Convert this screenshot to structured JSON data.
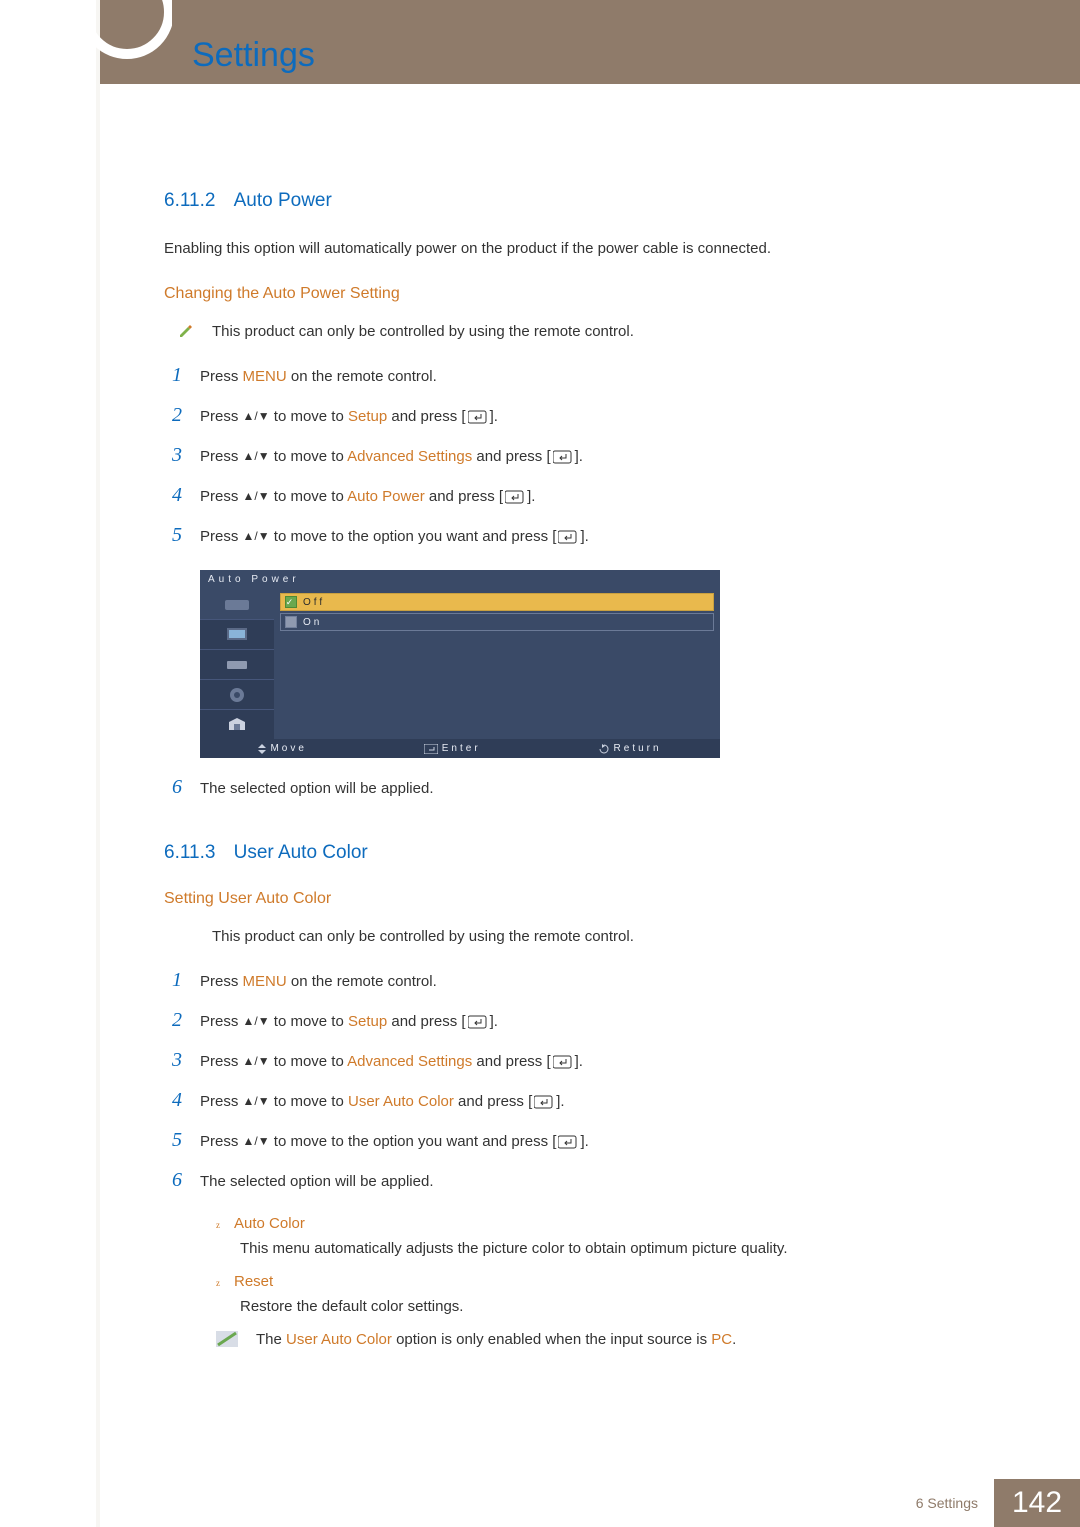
{
  "header": {
    "chapter_title": "Settings"
  },
  "section_a": {
    "num": "6.11.2",
    "title": "Auto Power",
    "intro": "Enabling this option will automatically power on the product if the power cable is connected.",
    "subhead": "Changing the Auto Power Setting",
    "note": "This product can only be controlled by using the remote control.",
    "steps": {
      "s1": {
        "n": "1",
        "a": "Press ",
        "menu": "MENU",
        "b": " on the remote control."
      },
      "s2": {
        "n": "2",
        "a": "Press ",
        "arrows": "▲/▼",
        "b": " to move to ",
        "t": "Setup",
        "c": " and press [",
        "d": "]."
      },
      "s3": {
        "n": "3",
        "a": "Press ",
        "arrows": "▲/▼",
        "b": " to move to ",
        "t": "Advanced Settings",
        "c": " and press [",
        "d": "]."
      },
      "s4": {
        "n": "4",
        "a": "Press ",
        "arrows": "▲/▼",
        "b": " to move to ",
        "t": "Auto Power",
        "c": " and press [",
        "d": "]."
      },
      "s5": {
        "n": "5",
        "a": "Press ",
        "arrows": "▲/▼",
        "b": " to move to the option you want and press [",
        "d": "]."
      },
      "s6": {
        "n": "6",
        "a": "The selected option will be applied."
      }
    }
  },
  "osd": {
    "title": "Auto Power",
    "opt_off": "Off",
    "opt_on": "On",
    "footer_move": "Move",
    "footer_enter": "Enter",
    "footer_return": "Return"
  },
  "section_b": {
    "num": "6.11.3",
    "title": "User Auto Color",
    "subhead": "Setting User Auto Color",
    "note": "This product can only be controlled by using the remote control.",
    "steps": {
      "s1": {
        "n": "1",
        "a": "Press ",
        "menu": "MENU",
        "b": " on the remote control."
      },
      "s2": {
        "n": "2",
        "a": "Press ",
        "arrows": "▲/▼",
        "b": " to move to ",
        "t": "Setup",
        "c": " and press [",
        "d": "]."
      },
      "s3": {
        "n": "3",
        "a": "Press ",
        "arrows": "▲/▼",
        "b": " to move to ",
        "t": "Advanced Settings",
        "c": " and press [",
        "d": "]."
      },
      "s4": {
        "n": "4",
        "a": "Press ",
        "arrows": "▲/▼",
        "b": " to move to ",
        "t": "User Auto Color",
        "c": " and press [",
        "d": "]."
      },
      "s5": {
        "n": "5",
        "a": "Press ",
        "arrows": "▲/▼",
        "b": " to move to the option you want and press [",
        "d": "]."
      },
      "s6": {
        "n": "6",
        "a": "The selected option will be applied."
      }
    },
    "bullets": {
      "b1_title": "Auto Color",
      "b1_desc": "This menu automatically adjusts the picture color to obtain optimum picture quality.",
      "b2_title": "Reset",
      "b2_desc": "Restore the default color settings."
    },
    "info": {
      "a": "The ",
      "t": "User Auto Color",
      "b": " option is only enabled when the input source is ",
      "pc": "PC",
      "c": "."
    }
  },
  "footer": {
    "label": "6 Settings",
    "page": "142"
  }
}
